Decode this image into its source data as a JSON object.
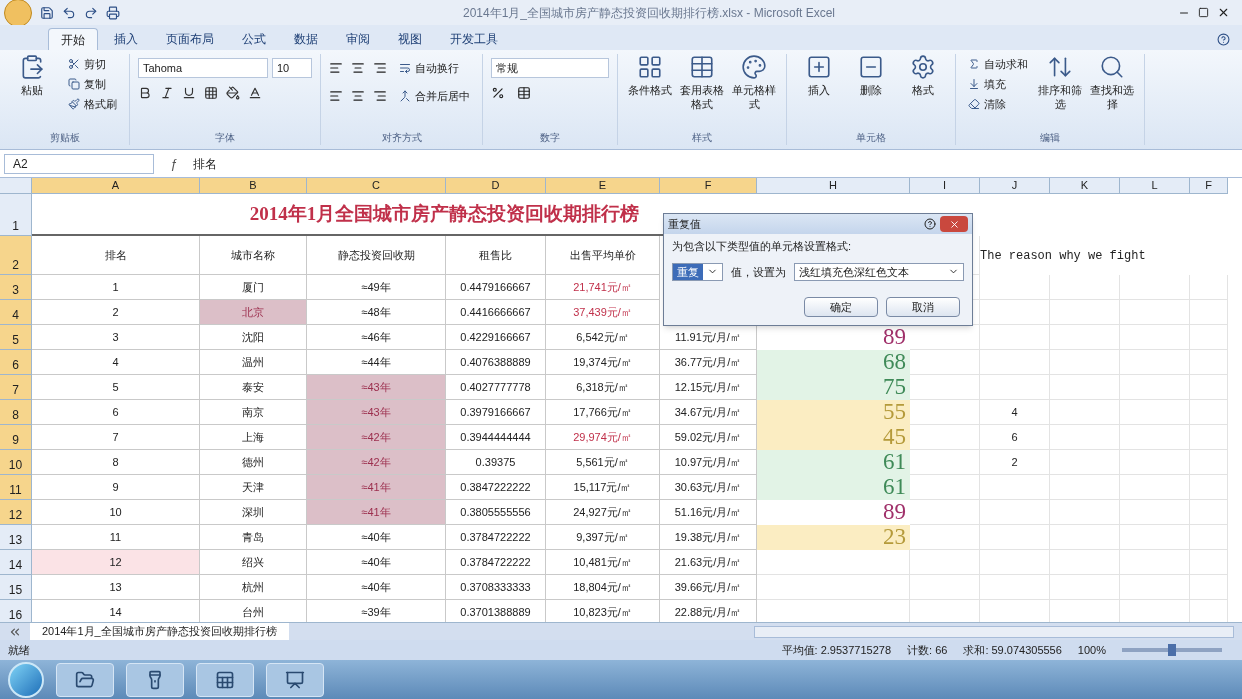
{
  "window": {
    "title": "2014年1月_全国城市房产静态投资回收期排行榜.xlsx - Microsoft Excel"
  },
  "tabs": [
    {
      "label": "开始",
      "selected": true
    },
    {
      "label": "插入",
      "selected": false
    },
    {
      "label": "页面布局",
      "selected": false
    },
    {
      "label": "公式",
      "selected": false
    },
    {
      "label": "数据",
      "selected": false
    },
    {
      "label": "审阅",
      "selected": false
    },
    {
      "label": "视图",
      "selected": false
    },
    {
      "label": "开发工具",
      "selected": false
    }
  ],
  "ribbon": [
    {
      "kind": "clipboard",
      "label": "剪贴板",
      "items": [
        "粘贴",
        "剪切",
        "复制",
        "格式刷"
      ]
    },
    {
      "kind": "font",
      "label": "字体",
      "items": [
        "Tahoma",
        "10"
      ]
    },
    {
      "kind": "alignment",
      "label": "对齐方式",
      "items": [
        "自动换行",
        "合并后居中"
      ]
    },
    {
      "kind": "number",
      "label": "数字",
      "items": [
        "常规"
      ]
    },
    {
      "kind": "large",
      "label": "样式",
      "items": [
        "条件格式",
        "套用表格格式",
        "单元格样式"
      ]
    },
    {
      "kind": "large",
      "label": "单元格",
      "items": [
        "插入",
        "删除",
        "格式"
      ]
    },
    {
      "kind": "editing",
      "label": "编辑",
      "items": [
        "自动求和",
        "填充",
        "清除",
        "排序和筛选",
        "查找和选择"
      ]
    }
  ],
  "formula_bar": {
    "name_box": "A2",
    "fx": "ƒ",
    "formula": "排名"
  },
  "columns": [
    {
      "label": "A",
      "selected": true
    },
    {
      "label": "B",
      "selected": true
    },
    {
      "label": "C",
      "selected": true
    },
    {
      "label": "D",
      "selected": true
    },
    {
      "label": "E",
      "selected": true
    },
    {
      "label": "F",
      "selected": true
    },
    {
      "label": "H",
      "selected": false
    },
    {
      "label": "I",
      "selected": false
    },
    {
      "label": "J",
      "selected": false
    },
    {
      "label": "K",
      "selected": false
    },
    {
      "label": "L",
      "selected": false
    },
    {
      "label": "F",
      "selected": false
    }
  ],
  "sheet": {
    "title_row": {
      "number": "1",
      "selected": false,
      "text": "2014年1月全国城市房产静态投资回收期排行榜"
    },
    "header_row": {
      "number": "2",
      "selected": true,
      "headers": [
        "排名",
        "城市名称",
        "静态投资回收期",
        "租售比",
        "出售平均单价"
      ],
      "note": "The reason why we fight"
    },
    "rows": [
      {
        "number": "3",
        "selected": true,
        "rank": "1",
        "city": "厦门",
        "period": "≈49年",
        "ratio": "0.4479166667",
        "price": "21,741元/㎡",
        "rank_marked": false,
        "city_marked": false,
        "period_marked": false,
        "price_red": true
      },
      {
        "number": "4",
        "selected": true,
        "rank": "2",
        "city": "北京",
        "period": "≈48年",
        "ratio": "0.4416666667",
        "price": "37,439元/㎡",
        "rank_marked": false,
        "city_marked": true,
        "period_marked": false,
        "price_red": true
      },
      {
        "number": "5",
        "selected": true,
        "rank": "3",
        "city": "沈阳",
        "period": "≈46年",
        "ratio": "0.4229166667",
        "price": "6,542元/㎡",
        "rent": "11.91元/月/㎡",
        "rank_marked": false,
        "city_marked": false,
        "period_marked": false,
        "price_red": false,
        "score": {
          "value": "89",
          "kind": "pink"
        }
      },
      {
        "number": "6",
        "selected": true,
        "rank": "4",
        "city": "温州",
        "period": "≈44年",
        "ratio": "0.4076388889",
        "price": "19,374元/㎡",
        "rent": "36.77元/月/㎡",
        "rank_marked": false,
        "city_marked": false,
        "period_marked": false,
        "price_red": false,
        "score": {
          "value": "68",
          "kind": "green"
        }
      },
      {
        "number": "7",
        "selected": true,
        "rank": "5",
        "city": "泰安",
        "period": "≈43年",
        "ratio": "0.4027777778",
        "price": "6,318元/㎡",
        "rent": "12.15元/月/㎡",
        "rank_marked": false,
        "city_marked": false,
        "period_marked": true,
        "price_red": false,
        "score": {
          "value": "75",
          "kind": "green"
        }
      },
      {
        "number": "8",
        "selected": true,
        "rank": "6",
        "city": "南京",
        "period": "≈43年",
        "ratio": "0.3979166667",
        "price": "17,766元/㎡",
        "rent": "34.67元/月/㎡",
        "rank_marked": false,
        "city_marked": false,
        "period_marked": true,
        "price_red": false,
        "score": {
          "value": "55",
          "kind": "yellow"
        },
        "j": "4"
      },
      {
        "number": "9",
        "selected": true,
        "rank": "7",
        "city": "上海",
        "period": "≈42年",
        "ratio": "0.3944444444",
        "price": "29,974元/㎡",
        "rent": "59.02元/月/㎡",
        "rank_marked": false,
        "city_marked": false,
        "period_marked": true,
        "price_red": true,
        "score": {
          "value": "45",
          "kind": "yellow"
        },
        "j": "6"
      },
      {
        "number": "10",
        "selected": true,
        "rank": "8",
        "city": "德州",
        "period": "≈42年",
        "ratio": "0.39375",
        "price": "5,561元/㎡",
        "rent": "10.97元/月/㎡",
        "rank_marked": false,
        "city_marked": false,
        "period_marked": true,
        "price_red": false,
        "score": {
          "value": "61",
          "kind": "green"
        },
        "j": "2"
      },
      {
        "number": "11",
        "selected": true,
        "rank": "9",
        "city": "天津",
        "period": "≈41年",
        "ratio": "0.3847222222",
        "price": "15,117元/㎡",
        "rent": "30.63元/月/㎡",
        "rank_marked": false,
        "city_marked": false,
        "period_marked": true,
        "price_red": false,
        "score": {
          "value": "61",
          "kind": "green"
        }
      },
      {
        "number": "12",
        "selected": true,
        "rank": "10",
        "city": "深圳",
        "period": "≈41年",
        "ratio": "0.3805555556",
        "price": "24,927元/㎡",
        "rent": "51.16元/月/㎡",
        "rank_marked": false,
        "city_marked": false,
        "period_marked": true,
        "price_red": false,
        "score": {
          "value": "89",
          "kind": "pink"
        }
      },
      {
        "number": "13",
        "selected": false,
        "rank": "11",
        "city": "青岛",
        "period": "≈40年",
        "ratio": "0.3784722222",
        "price": "9,397元/㎡",
        "rent": "19.38元/月/㎡",
        "rank_marked": false,
        "city_marked": false,
        "period_marked": false,
        "price_red": false,
        "score": {
          "value": "23",
          "kind": "yellow"
        }
      },
      {
        "number": "14",
        "selected": false,
        "rank": "12",
        "city": "绍兴",
        "period": "≈40年",
        "ratio": "0.3784722222",
        "price": "10,481元/㎡",
        "rent": "21.63元/月/㎡",
        "rank_marked": true,
        "city_marked": false,
        "period_marked": false,
        "price_red": false
      },
      {
        "number": "15",
        "selected": false,
        "rank": "13",
        "city": "杭州",
        "period": "≈40年",
        "ratio": "0.3708333333",
        "price": "18,804元/㎡",
        "rent": "39.66元/月/㎡",
        "rank_marked": false,
        "city_marked": false,
        "period_marked": false,
        "price_red": false
      },
      {
        "number": "16",
        "selected": false,
        "rank": "14",
        "city": "台州",
        "period": "≈39年",
        "ratio": "0.3701388889",
        "price": "10,823元/㎡",
        "rent": "22.88元/月/㎡",
        "rank_marked": false,
        "city_marked": false,
        "period_marked": false,
        "price_red": false
      }
    ]
  },
  "dialog": {
    "title": "重复值",
    "prompt": "为包含以下类型值的单元格设置格式:",
    "type_value": "重复",
    "connector": "值，设置为",
    "format_value": "浅红填充色深红色文本",
    "buttons": [
      "确定",
      "取消"
    ]
  },
  "sheet_tab": {
    "label": "2014年1月_全国城市房产静态投资回收期排行榜",
    "selected": true
  },
  "status_bar": {
    "state": "就绪",
    "average": "平均值: 2.9537715278",
    "count": "计数: 66",
    "sum": "求和: 59.074305556",
    "zoom": "100%",
    "level": 0.5
  }
}
